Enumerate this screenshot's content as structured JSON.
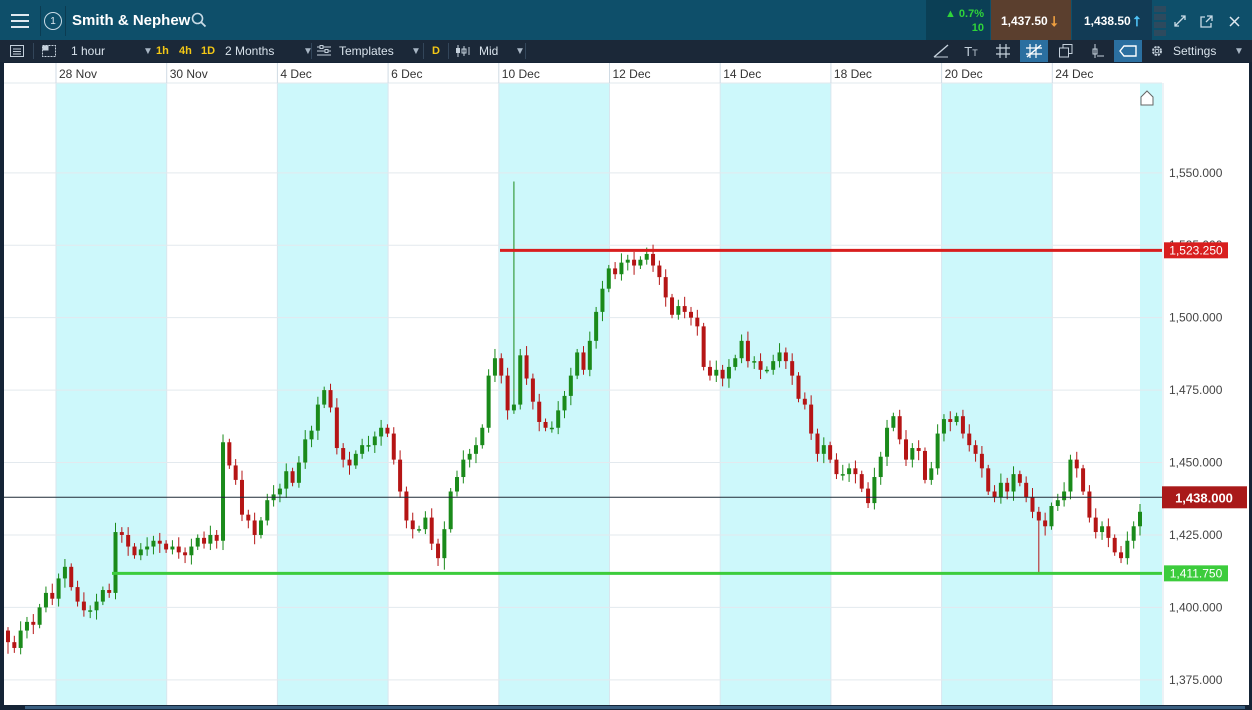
{
  "header": {
    "instrument_id": "1",
    "symbol": "Smith & Nephew",
    "change_pct": "▲ 0.7%",
    "change_abs": "10",
    "sell_price": "1,437.50",
    "buy_price": "1,438.50"
  },
  "toolbar": {
    "interval": "1 hour",
    "quick_1h": "1h",
    "quick_4h": "4h",
    "quick_1d": "1D",
    "range": "2 Months",
    "templates": "Templates",
    "d_badge": "D",
    "price_mode": "Mid",
    "settings": "Settings"
  },
  "colors": {
    "bull": "#1a8a1a",
    "bear": "#b51515",
    "session_shade": "#cdf8fb",
    "resistance": "#d81e1e",
    "support": "#3ccc3c",
    "current_tag": "#a91919"
  },
  "chart_data": {
    "type": "candlestick",
    "x_tick_labels": [
      "28 Nov",
      "30 Nov",
      "4 Dec",
      "6 Dec",
      "10 Dec",
      "12 Dec",
      "14 Dec",
      "18 Dec",
      "20 Dec",
      "24 Dec"
    ],
    "y_tick_labels": [
      "1,550.000",
      "1,525.000",
      "1,500.000",
      "1,475.000",
      "1,450.000",
      "1,425.000",
      "1,400.000",
      "1,375.000"
    ],
    "y_ticks": [
      1550,
      1525,
      1500,
      1475,
      1450,
      1425,
      1400,
      1375
    ],
    "ylim": [
      1367,
      1581
    ],
    "grid": true,
    "shaded_sessions": true,
    "horizontal_lines": [
      {
        "label": "1,523.250",
        "value": 1523.25,
        "role": "resistance"
      },
      {
        "label": "1,411.750",
        "value": 1411.75,
        "role": "support"
      }
    ],
    "current_price": {
      "label": "1,438.000",
      "value": 1438.0
    },
    "candles_close": [
      1388,
      1386,
      1392,
      1395,
      1394,
      1400,
      1405,
      1403,
      1410,
      1414,
      1407,
      1402,
      1399,
      1399,
      1402,
      1406,
      1405,
      1426,
      1425,
      1421,
      1418,
      1420,
      1421,
      1423,
      1422,
      1420,
      1421,
      1419,
      1418,
      1421,
      1424,
      1422,
      1425,
      1423,
      1457,
      1449,
      1444,
      1432,
      1430,
      1425,
      1430,
      1437,
      1439,
      1441,
      1447,
      1443,
      1450,
      1458,
      1461,
      1470,
      1475,
      1469,
      1455,
      1451,
      1449,
      1453,
      1456,
      1456,
      1459,
      1462,
      1460,
      1451,
      1440,
      1430,
      1427,
      1427,
      1431,
      1422,
      1417,
      1427,
      1440,
      1445,
      1451,
      1453,
      1456,
      1462,
      1480,
      1486,
      1480,
      1468,
      1470,
      1487,
      1479,
      1471,
      1464,
      1462,
      1462,
      1468,
      1473,
      1480,
      1488,
      1482,
      1492,
      1502,
      1510,
      1517,
      1515,
      1519,
      1520,
      1518,
      1520,
      1522,
      1518,
      1514,
      1507,
      1501,
      1504,
      1502,
      1500,
      1497,
      1483,
      1480,
      1482,
      1479,
      1483,
      1486,
      1492,
      1485,
      1485,
      1482,
      1482,
      1485,
      1488,
      1485,
      1480,
      1472,
      1470,
      1460,
      1453,
      1456,
      1451,
      1446,
      1446,
      1448,
      1446,
      1441,
      1436,
      1445,
      1452,
      1462,
      1466,
      1458,
      1451,
      1455,
      1454,
      1444,
      1448,
      1460,
      1465,
      1464,
      1466,
      1460,
      1456,
      1453,
      1448,
      1440,
      1438,
      1443,
      1440,
      1446,
      1443,
      1438,
      1433,
      1430,
      1428,
      1435,
      1437,
      1440,
      1451,
      1448,
      1440,
      1431,
      1426,
      1428,
      1424,
      1419,
      1417,
      1423,
      1428,
      1433
    ]
  }
}
